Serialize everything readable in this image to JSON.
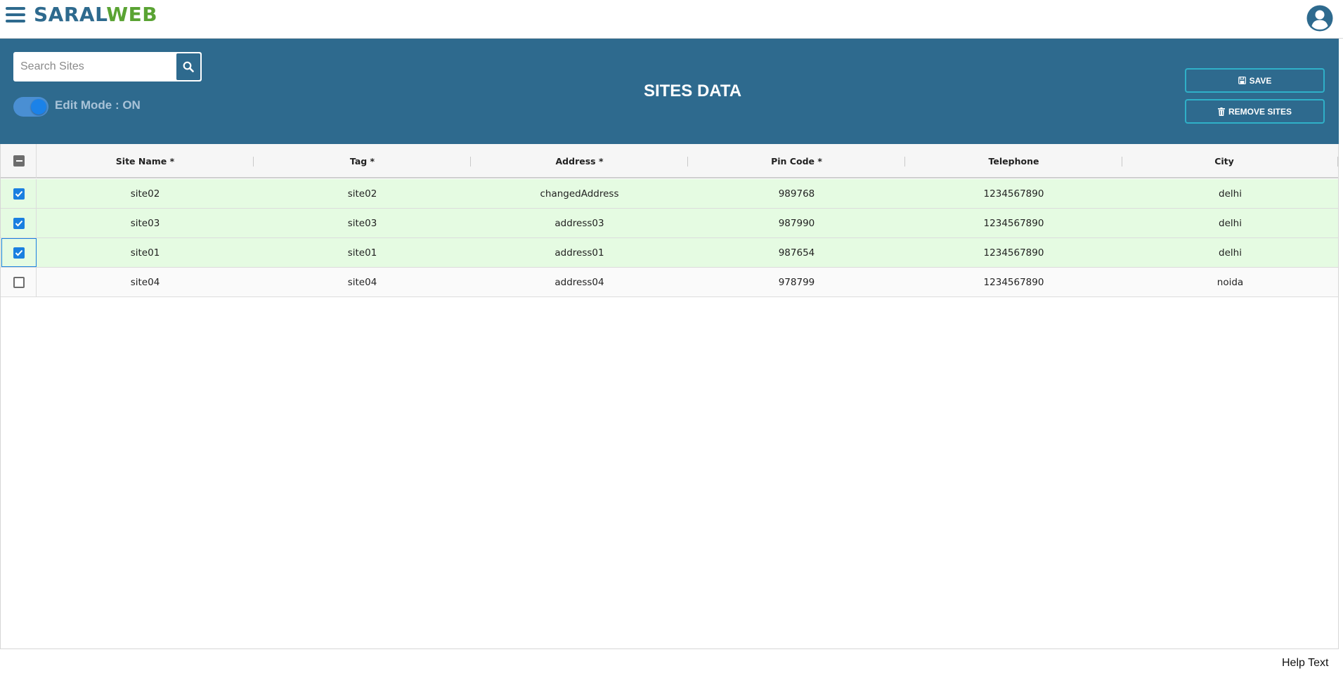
{
  "app": {
    "logo_part1": "SARAL",
    "logo_part2": "WEB"
  },
  "header": {
    "search": {
      "placeholder": "Search Sites",
      "value": ""
    },
    "edit_mode_label": "Edit Mode : ON",
    "edit_mode_on": true,
    "title": "SITES DATA",
    "save_label": "SAVE",
    "remove_label": "REMOVE SITES"
  },
  "table": {
    "columns": [
      "Site Name *",
      "Tag *",
      "Address *",
      "Pin Code *",
      "Telephone",
      "City"
    ],
    "select_all_state": "indeterminate",
    "rows": [
      {
        "selected": true,
        "site_name": "site02",
        "tag": "site02",
        "address": "changedAddress",
        "pin_code": "989768",
        "telephone": "1234567890",
        "city": "delhi"
      },
      {
        "selected": true,
        "site_name": "site03",
        "tag": "site03",
        "address": "address03",
        "pin_code": "987990",
        "telephone": "1234567890",
        "city": "delhi"
      },
      {
        "selected": true,
        "site_name": "site01",
        "tag": "site01",
        "address": "address01",
        "pin_code": "987654",
        "telephone": "1234567890",
        "city": "delhi"
      },
      {
        "selected": false,
        "site_name": "site04",
        "tag": "site04",
        "address": "address04",
        "pin_code": "978799",
        "telephone": "1234567890",
        "city": "noida"
      }
    ]
  },
  "footer": {
    "help_text": "Help Text"
  },
  "colors": {
    "brand_blue": "#2e6a8e",
    "brand_green": "#5aa333",
    "selected_row": "#e5fbe2",
    "checkbox_blue": "#1a7fe0",
    "button_border": "#2fb0c8"
  },
  "icons": {
    "menu": "hamburger-menu-icon",
    "user": "user-account-icon",
    "search": "search-icon",
    "save": "floppy-disk-icon",
    "remove": "trash-icon"
  }
}
